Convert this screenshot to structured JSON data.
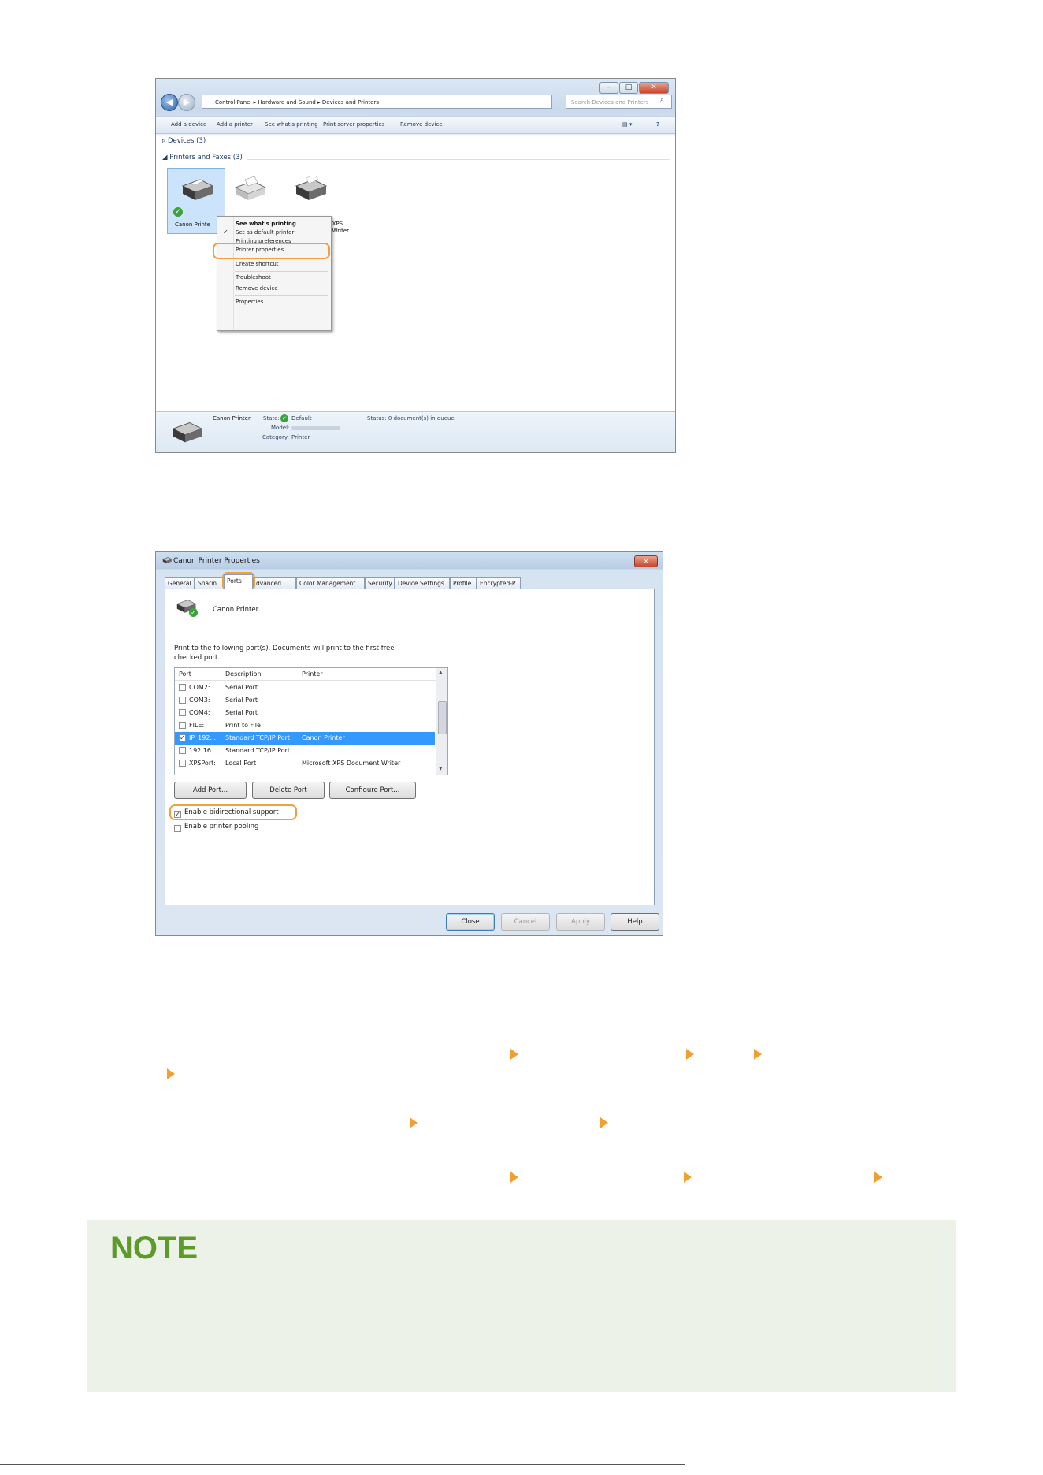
{
  "window1": {
    "address": [
      "Control Panel",
      "Hardware and Sound",
      "Devices and Printers"
    ],
    "search_placeholder": "Search Devices and Printers",
    "toolbar": [
      "Add a device",
      "Add a printer",
      "See what's printing",
      "Print server properties",
      "Remove device"
    ],
    "groups": {
      "devices": "Devices (3)",
      "printers": "Printers and Faxes (3)"
    },
    "printers": [
      "Canon Printe",
      "...t XPS",
      "...t Writer"
    ],
    "context_menu": {
      "items": [
        "See what's printing",
        "Set as default printer",
        "Printing preferences",
        "Printer properties",
        "Create shortcut",
        "Troubleshoot",
        "Remove device",
        "Properties"
      ],
      "highlighted": "Printer properties"
    },
    "details": {
      "name": "Canon Printer",
      "state_label": "State:",
      "state_value": "Default",
      "status": "Status: 0 document(s) in queue",
      "model_label": "Model:",
      "category_label": "Category:",
      "category_value": "Printer"
    }
  },
  "window2": {
    "title": "Canon Printer Properties",
    "tabs": [
      "General",
      "Sharin",
      "Ports",
      "dvanced",
      "Color Management",
      "Security",
      "Device Settings",
      "Profile",
      "Encrypted-P"
    ],
    "active_tab": "Ports",
    "printer_name": "Canon Printer",
    "instructions_line1": "Print to the following port(s). Documents will print to the first free",
    "instructions_line2": "checked port.",
    "columns": [
      "Port",
      "Description",
      "Printer"
    ],
    "ports": [
      {
        "port": "COM2:",
        "description": "Serial Port",
        "printer": "",
        "checked": false,
        "selected": false
      },
      {
        "port": "COM3:",
        "description": "Serial Port",
        "printer": "",
        "checked": false,
        "selected": false
      },
      {
        "port": "COM4:",
        "description": "Serial Port",
        "printer": "",
        "checked": false,
        "selected": false
      },
      {
        "port": "FILE:",
        "description": "Print to File",
        "printer": "",
        "checked": false,
        "selected": false
      },
      {
        "port": "IP_192...",
        "description": "Standard TCP/IP Port",
        "printer": "Canon Printer",
        "checked": true,
        "selected": true
      },
      {
        "port": "192.16...",
        "description": "Standard TCP/IP Port",
        "printer": "",
        "checked": false,
        "selected": false
      },
      {
        "port": "XPSPort:",
        "description": "Local Port",
        "printer": "Microsoft XPS Document Writer",
        "checked": false,
        "selected": false
      }
    ],
    "port_buttons": [
      "Add Port...",
      "Delete Port",
      "Configure Port..."
    ],
    "bidirectional_label": "Enable bidirectional support",
    "bidirectional_checked": true,
    "pooling_label": "Enable printer pooling",
    "pooling_checked": false,
    "footer_buttons": [
      "Close",
      "Cancel",
      "Apply",
      "Help"
    ]
  },
  "note": {
    "title": "NOTE"
  },
  "colors": {
    "accent_orange": "#f0a02f",
    "note_green": "#5c9a2a",
    "note_bg": "#edf2e8",
    "selection_blue": "#3399ff"
  }
}
